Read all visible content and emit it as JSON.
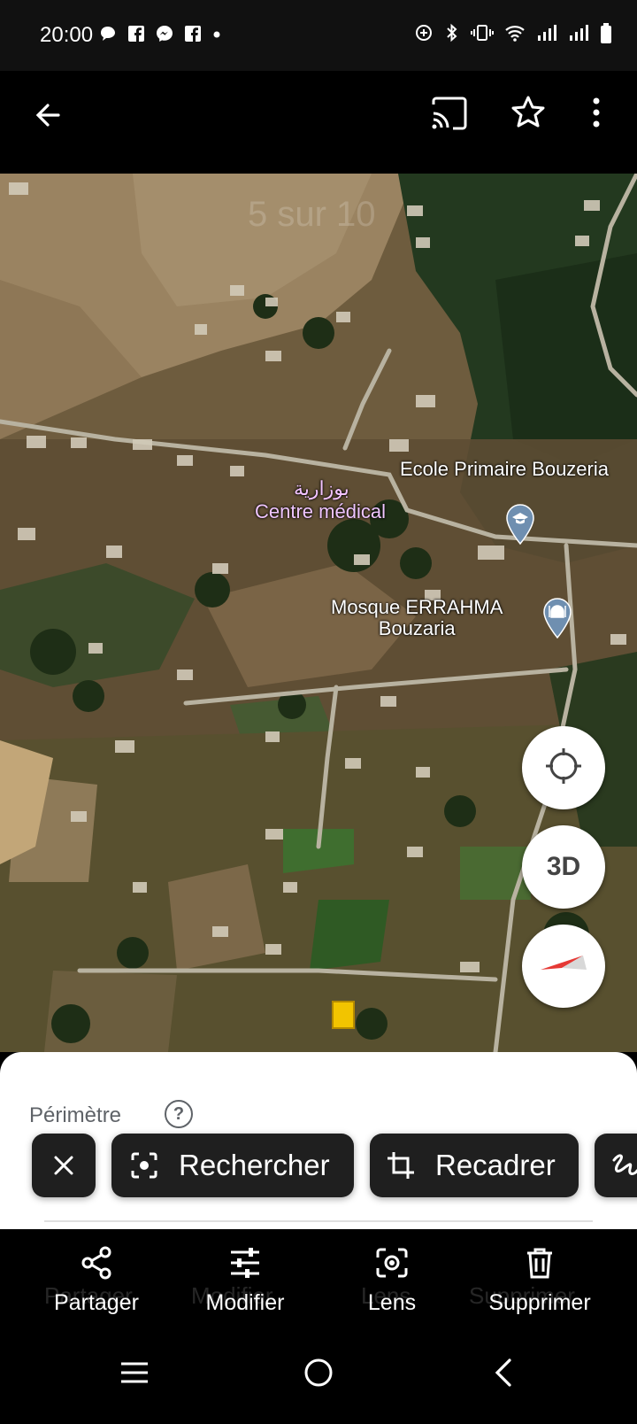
{
  "status_bar": {
    "time": "20:00",
    "left_icons": [
      "chat-bubble-icon",
      "facebook-icon",
      "messenger-icon",
      "facebook-icon",
      "dot-icon"
    ],
    "right_icons": [
      "data-saver-icon",
      "bluetooth-icon",
      "vibrate-icon",
      "wifi-icon",
      "signal-icon",
      "signal-icon",
      "battery-icon"
    ]
  },
  "top_bar": {
    "back_icon": "arrow-left-icon",
    "cast_icon": "cast-icon",
    "favorite_icon": "star-outline-icon",
    "more_icon": "more-vert-icon",
    "ghost_counter": "5 sur 10"
  },
  "map": {
    "labels": {
      "school": "Ecole Primaire Bouzeria",
      "arabic_place": "بوزارية",
      "medical": "Centre médical",
      "mosque_line1": "Mosque ERRAHMA",
      "mosque_line2": "Bouzaria"
    },
    "buttons": {
      "locate_icon": "my-location-icon",
      "three_d": "3D",
      "compass_icon": "compass-icon"
    }
  },
  "sheet": {
    "title": "Périmètre",
    "help_icon": "help-circle-icon",
    "ghost_subtitle": "Zone"
  },
  "chips": {
    "close_icon": "close-icon",
    "search_label": "Rechercher",
    "search_icon": "lens-search-icon",
    "crop_label": "Recadrer",
    "crop_icon": "crop-icon",
    "draw_icon": "scribble-icon"
  },
  "bottom_actions": [
    {
      "label": "Partager",
      "icon": "share-icon"
    },
    {
      "label": "Modifier",
      "icon": "tune-icon"
    },
    {
      "label": "Lens",
      "icon": "lens-icon"
    },
    {
      "label": "Supprimer",
      "icon": "trash-icon"
    }
  ],
  "ghost_actions": [
    "Partager",
    "Modifier",
    "Lens",
    "Supprimer"
  ],
  "nav_bar": {
    "recents_icon": "recents-icon",
    "home_icon": "home-circle-icon",
    "back_icon": "nav-back-icon"
  },
  "colors": {
    "sheet_bg": "#ffffff",
    "chip_bg": "#1f1f1f",
    "compass_red": "#e53935",
    "map_pin": "#6f8fb0",
    "label_pink": "#f3c3ff"
  }
}
